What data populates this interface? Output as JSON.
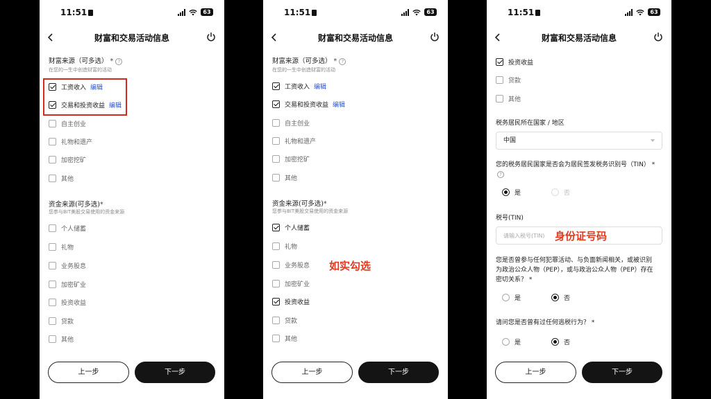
{
  "status_bar": {
    "time": "11:51",
    "battery": "63"
  },
  "nav": {
    "title": "财富和交易活动信息"
  },
  "wealth_source": {
    "title": "财富来源（可多选）",
    "required_mark": "*",
    "help": "?",
    "subtitle": "在您的一生中创造财富的活动",
    "edit_label": "编辑",
    "items": [
      {
        "label": "工资收入",
        "checked": true,
        "editable": true
      },
      {
        "label": "交易和投资收益",
        "checked": true,
        "editable": true
      },
      {
        "label": "自主创业",
        "checked": false
      },
      {
        "label": "礼物和遗产",
        "checked": false
      },
      {
        "label": "加密挖矿",
        "checked": false
      },
      {
        "label": "其他",
        "checked": false
      }
    ]
  },
  "fund_source": {
    "title": "资金来源(可多选)",
    "required_mark": "*",
    "subtitle": "您参与BIT美股交易使用的资金来源",
    "items": [
      {
        "label": "个人储蓄"
      },
      {
        "label": "礼物"
      },
      {
        "label": "业务股息"
      },
      {
        "label": "加密矿业"
      },
      {
        "label": "投资收益"
      },
      {
        "label": "贷款"
      },
      {
        "label": "其他"
      }
    ],
    "screen2_checked": [
      true,
      false,
      false,
      false,
      true,
      false,
      false
    ]
  },
  "buttons": {
    "prev": "上一步",
    "next": "下一步"
  },
  "annotations": {
    "check_truthfully": "如实勾选",
    "id_number": "身份证号码"
  },
  "screen3": {
    "top_items": [
      {
        "label": "投资收益",
        "checked": true
      },
      {
        "label": "贷款",
        "checked": false
      },
      {
        "label": "其他",
        "checked": false
      }
    ],
    "tax_country_label": "税务居民所在国家 / 地区",
    "tax_country_value": "中国",
    "tin_question": "您的税务居民国家是否会为居民签发税务识别号（TIN）",
    "required_mark": "*",
    "help": "?",
    "tin_options": [
      "是",
      "否"
    ],
    "tin_selected": "是",
    "tin_label": "税号(TIN)",
    "tin_placeholder": "请输入税号(TIN)",
    "pep_question_line1": "您是否曾参与任何犯罪活动、与负面新闻相关，或被识别",
    "pep_question_line2": "为政治公众人物（PEP），或与政治公众人物（PEP）存在",
    "pep_question_line3": "密切关系？",
    "pep_options": [
      "是",
      "否"
    ],
    "pep_selected": "否",
    "tax_evasion_question": "请问您是否曾有过任何逃税行为？",
    "tax_evasion_options": [
      "是",
      "否"
    ],
    "tax_evasion_selected": "否"
  },
  "icons": {
    "back": "chevron-left-icon",
    "power": "power-icon",
    "signal": "signal-icon",
    "wifi": "wifi-icon",
    "battery": "battery-icon",
    "lock": "lock-icon"
  },
  "colors": {
    "highlight_red": "#d42a1e",
    "annotation_red": "#e33a1f",
    "link_blue": "#2a55d0",
    "primary_button": "#141414"
  }
}
